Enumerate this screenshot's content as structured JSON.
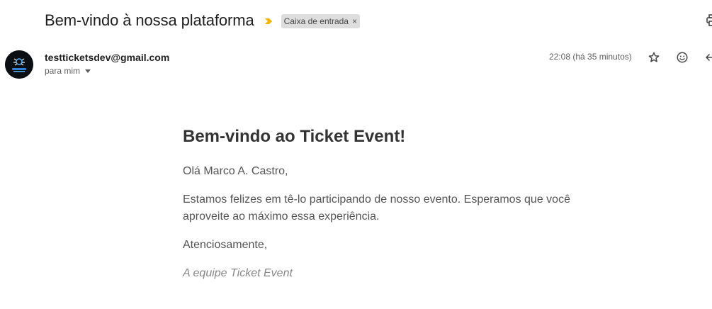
{
  "header": {
    "subject": "Bem-vindo à nossa plataforma",
    "label": "Caixa de entrada",
    "label_close": "×"
  },
  "message": {
    "sender_email": "testticketsdev@gmail.com",
    "recipient": "para mim",
    "timestamp": "22:08 (há 35 minutos)"
  },
  "body": {
    "heading": "Bem-vindo ao Ticket Event!",
    "greeting": "Olá Marco A. Castro,",
    "paragraph": "Estamos felizes em tê-lo participando de nosso evento. Esperamos que você aproveite ao máximo essa experiência.",
    "closing": "Atenciosamente,",
    "signature": "A equipe Ticket Event"
  },
  "icons": {
    "importance": "importance-marker-icon",
    "print": "print-icon",
    "star": "star-icon",
    "emoji": "emoji-icon",
    "reply": "reply-icon",
    "recipient_details": "chevron-down-icon"
  },
  "colors": {
    "importance": "#f4b400",
    "label_chip_bg": "#dddddd",
    "avatar_bg": "#0b0f14",
    "heading_text": "#333333",
    "body_text": "#555555",
    "signature_text": "#888888"
  }
}
